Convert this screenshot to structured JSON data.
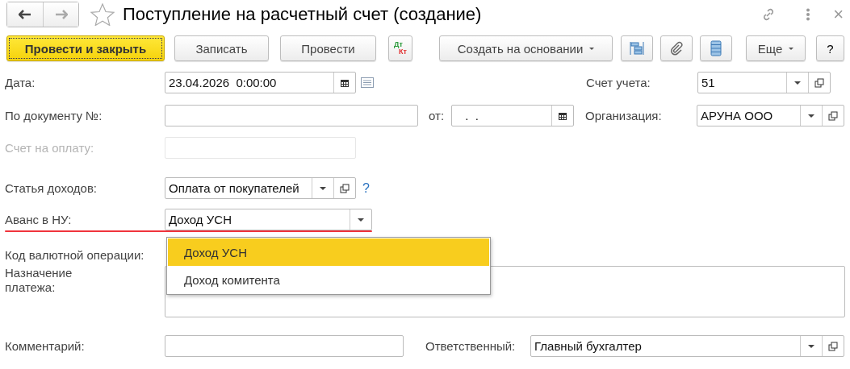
{
  "window": {
    "title": "Поступление на расчетный счет (создание)",
    "close": "×"
  },
  "toolbar": {
    "post_close": "Провести и закрыть",
    "save": "Записать",
    "post": "Провести",
    "dt": "Дт",
    "kt": "Кт",
    "create_based_on": "Создать на основании",
    "more": "Еще",
    "help": "?"
  },
  "form": {
    "date": {
      "label": "Дата:",
      "value": "23.04.2026  0:00:00"
    },
    "account": {
      "label": "Счет учета:",
      "value": "51"
    },
    "doc_number": {
      "label": "По документу №:"
    },
    "doc_date": {
      "label": "от:",
      "value": " .  ."
    },
    "organization": {
      "label": "Организация:",
      "value": "АРУНА ООО"
    },
    "invoice": {
      "label": "Счет на оплату:"
    },
    "income_item": {
      "label": "Статья доходов:",
      "value": "Оплата от покупателей",
      "help": "?"
    },
    "advance": {
      "label": "Аванс в НУ:",
      "value": "Доход УСН"
    },
    "currency_code": {
      "label": "Код валютной операции:"
    },
    "purpose": {
      "label": "Назначение платежа:"
    },
    "comment": {
      "label": "Комментарий:"
    },
    "responsible": {
      "label": "Ответственный:",
      "value": "Главный бухгалтер"
    }
  },
  "dropdown": {
    "options": [
      {
        "label": "Доход УСН",
        "selected": true
      },
      {
        "label": "Доход комитента",
        "selected": false
      }
    ]
  }
}
